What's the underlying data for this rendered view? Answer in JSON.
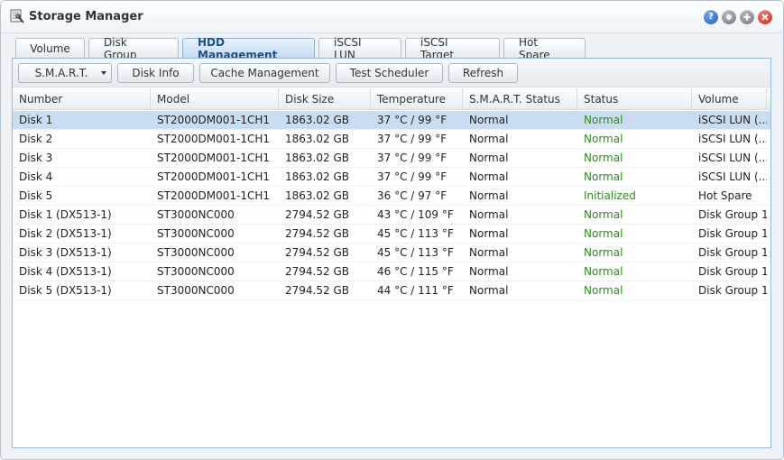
{
  "window": {
    "title": "Storage Manager",
    "help_glyph": "?"
  },
  "tabs": [
    {
      "label": "Volume",
      "active": false
    },
    {
      "label": "Disk Group",
      "active": false
    },
    {
      "label": "HDD Management",
      "active": true
    },
    {
      "label": "iSCSI LUN",
      "active": false
    },
    {
      "label": "iSCSI Target",
      "active": false
    },
    {
      "label": "Hot Spare",
      "active": false
    }
  ],
  "toolbar": {
    "smart_label": "S.M.A.R.T.",
    "disk_info_label": "Disk Info",
    "cache_label": "Cache Management",
    "scheduler_label": "Test Scheduler",
    "refresh_label": "Refresh"
  },
  "table": {
    "columns": [
      "Number",
      "Model",
      "Disk Size",
      "Temperature",
      "S.M.A.R.T. Status",
      "Status",
      "Volume"
    ],
    "rows": [
      [
        "Disk 1",
        "ST2000DM001-1CH1",
        "1863.02 GB",
        "37 °C / 99 °F",
        "Normal",
        "Normal",
        "iSCSI LUN (..."
      ],
      [
        "Disk 2",
        "ST2000DM001-1CH1",
        "1863.02 GB",
        "37 °C / 99 °F",
        "Normal",
        "Normal",
        "iSCSI LUN (..."
      ],
      [
        "Disk 3",
        "ST2000DM001-1CH1",
        "1863.02 GB",
        "37 °C / 99 °F",
        "Normal",
        "Normal",
        "iSCSI LUN (..."
      ],
      [
        "Disk 4",
        "ST2000DM001-1CH1",
        "1863.02 GB",
        "37 °C / 99 °F",
        "Normal",
        "Normal",
        "iSCSI LUN (..."
      ],
      [
        "Disk 5",
        "ST2000DM001-1CH1",
        "1863.02 GB",
        "36 °C / 97 °F",
        "Normal",
        "Initialized",
        "Hot Spare"
      ],
      [
        "Disk 1 (DX513-1)",
        "ST3000NC000",
        "2794.52 GB",
        "43 °C / 109 °F",
        "Normal",
        "Normal",
        "Disk Group 1"
      ],
      [
        "Disk 2 (DX513-1)",
        "ST3000NC000",
        "2794.52 GB",
        "45 °C / 113 °F",
        "Normal",
        "Normal",
        "Disk Group 1"
      ],
      [
        "Disk 3 (DX513-1)",
        "ST3000NC000",
        "2794.52 GB",
        "45 °C / 113 °F",
        "Normal",
        "Normal",
        "Disk Group 1"
      ],
      [
        "Disk 4 (DX513-1)",
        "ST3000NC000",
        "2794.52 GB",
        "46 °C / 115 °F",
        "Normal",
        "Normal",
        "Disk Group 1"
      ],
      [
        "Disk 5 (DX513-1)",
        "ST3000NC000",
        "2794.52 GB",
        "44 °C / 111 °F",
        "Normal",
        "Normal",
        "Disk Group 1"
      ]
    ],
    "selected_row": 0
  },
  "colors": {
    "status_green": "#2e8b1d",
    "selection": "#cadcf2",
    "active_tab_text": "#1e4f8a"
  },
  "icons": [
    "storage-manager-icon",
    "help-icon",
    "minimize-icon",
    "maximize-icon",
    "close-icon",
    "chevron-down-icon"
  ]
}
